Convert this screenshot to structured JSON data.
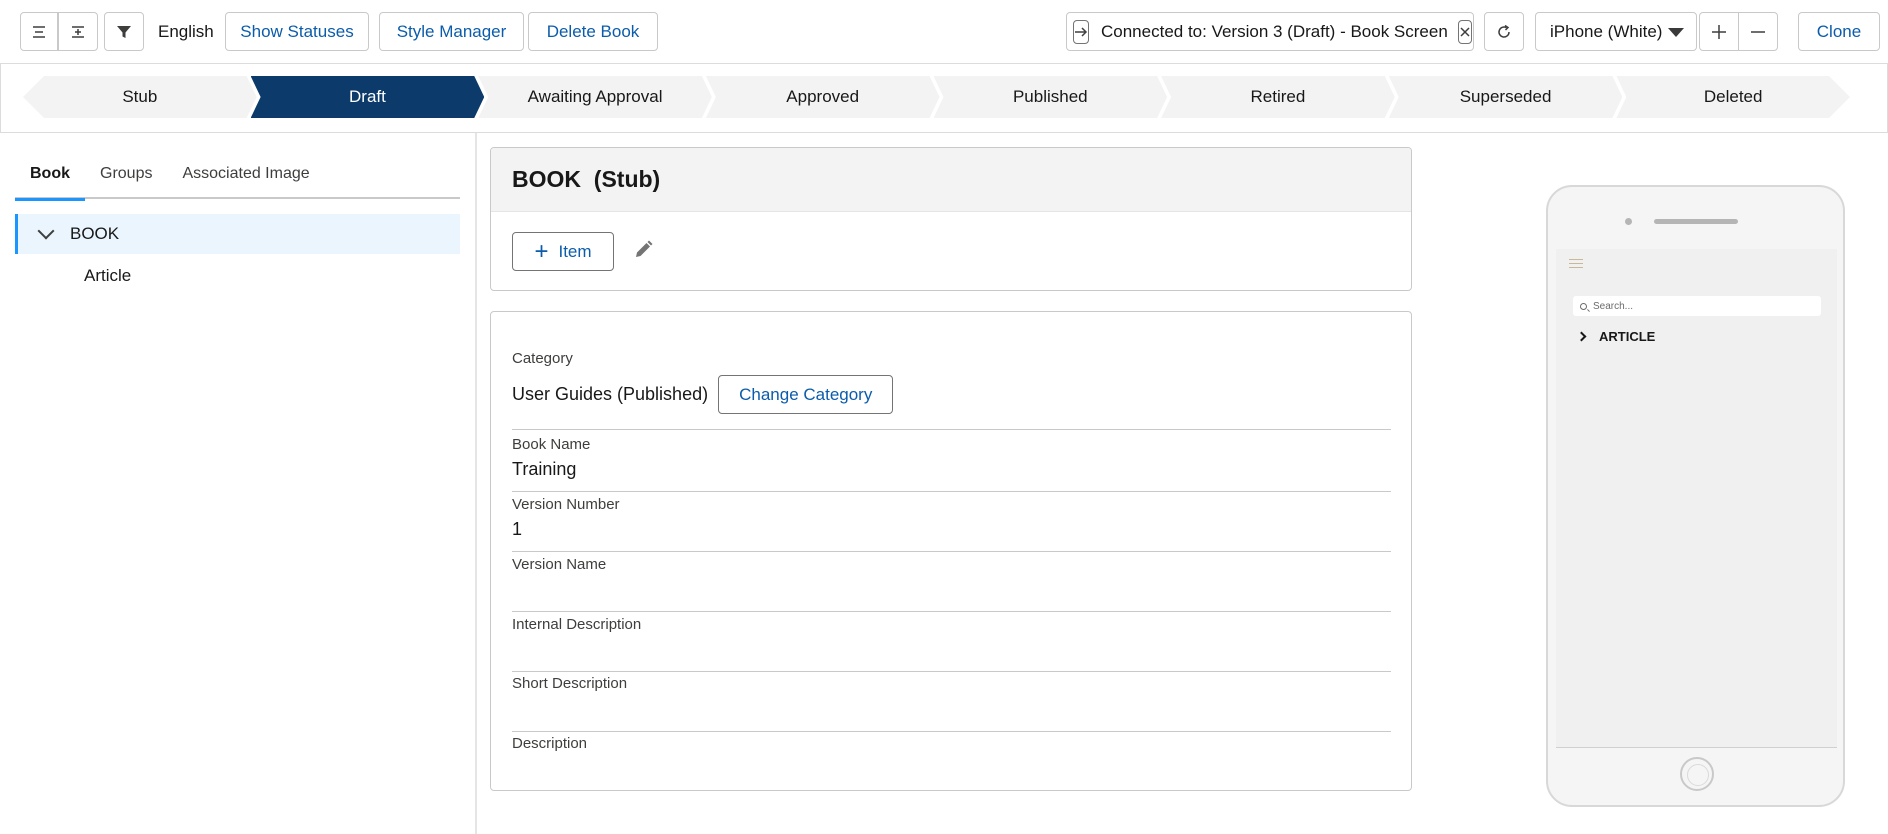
{
  "toolbar": {
    "language": "English",
    "show_statuses_label": "Show Statuses",
    "style_manager_label": "Style Manager",
    "delete_book_label": "Delete Book",
    "connection_text": "Connected to: Version 3 (Draft) - Book Screen",
    "device_select": "iPhone (White)",
    "clone_label": "Clone",
    "icons": [
      "collapse-all-icon",
      "expand-all-icon",
      "filter-icon",
      "link-arrow-icon",
      "close-icon",
      "refresh-icon",
      "plus-icon",
      "minus-icon"
    ]
  },
  "path": {
    "steps": [
      "Stub",
      "Draft",
      "Awaiting Approval",
      "Approved",
      "Published",
      "Retired",
      "Superseded",
      "Deleted"
    ],
    "active": "Draft",
    "active_color": "#0b3a6b"
  },
  "left_panel": {
    "tabs": [
      "Book",
      "Groups",
      "Associated Image"
    ],
    "active_tab": "Book",
    "tree": {
      "root": "BOOK",
      "children": [
        "Article"
      ]
    }
  },
  "book_card": {
    "title": "BOOK  (Stub)",
    "item_button": "Item"
  },
  "details": {
    "category_label": "Category",
    "category_value": "User Guides (Published)",
    "change_category_label": "Change Category",
    "book_name_label": "Book Name",
    "book_name_value": "Training",
    "version_number_label": "Version Number",
    "version_number_value": "1",
    "version_name_label": "Version Name",
    "version_name_value": "",
    "internal_description_label": "Internal Description",
    "internal_description_value": "",
    "short_description_label": "Short Description",
    "short_description_value": "",
    "description_label": "Description",
    "description_value": ""
  },
  "phone_preview": {
    "search_placeholder": "Search...",
    "article_label": "ARTICLE"
  },
  "colors": {
    "accent_blue": "#1b96ff",
    "link_blue": "#0b5cab",
    "active_step": "#0b3a6b",
    "selected_row_bg": "#eaf5fe"
  }
}
